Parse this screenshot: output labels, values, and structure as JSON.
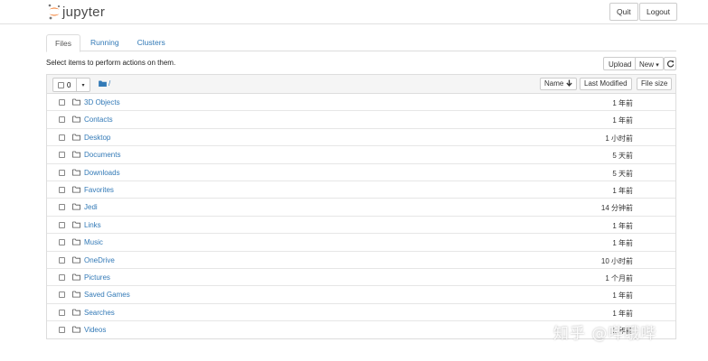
{
  "header": {
    "logo_text": "jupyter",
    "quit_label": "Quit",
    "logout_label": "Logout",
    "logo_color": "#f37726"
  },
  "tabs": [
    {
      "label": "Files",
      "active": true
    },
    {
      "label": "Running",
      "active": false
    },
    {
      "label": "Clusters",
      "active": false
    }
  ],
  "hint": "Select items to perform actions on them.",
  "toolbar": {
    "upload_label": "Upload",
    "new_label": "New",
    "new_caret": "▾",
    "refresh_icon": "refresh-icon"
  },
  "list_header": {
    "selected_count": "0",
    "dropdown_caret": "▾",
    "breadcrumb": "/",
    "name_label": "Name",
    "name_sort_icon": "arrow-down-icon",
    "last_modified_label": "Last Modified",
    "file_size_label": "File size"
  },
  "rows": [
    {
      "name": "3D Objects",
      "modified": "1 年前"
    },
    {
      "name": "Contacts",
      "modified": "1 年前"
    },
    {
      "name": "Desktop",
      "modified": "1 小时前"
    },
    {
      "name": "Documents",
      "modified": "5 天前"
    },
    {
      "name": "Downloads",
      "modified": "5 天前"
    },
    {
      "name": "Favorites",
      "modified": "1 年前"
    },
    {
      "name": "Jedi",
      "modified": "14 分钟前"
    },
    {
      "name": "Links",
      "modified": "1 年前"
    },
    {
      "name": "Music",
      "modified": "1 年前"
    },
    {
      "name": "OneDrive",
      "modified": "10 小时前"
    },
    {
      "name": "Pictures",
      "modified": "1 个月前"
    },
    {
      "name": "Saved Games",
      "modified": "1 年前"
    },
    {
      "name": "Searches",
      "modified": "1 年前"
    },
    {
      "name": "Videos",
      "modified": "1 年前"
    }
  ],
  "watermark": "知乎 @哔哦哔",
  "colors": {
    "link": "#337ab7",
    "border": "#dddddd",
    "header_bg": "#f5f5f5"
  }
}
